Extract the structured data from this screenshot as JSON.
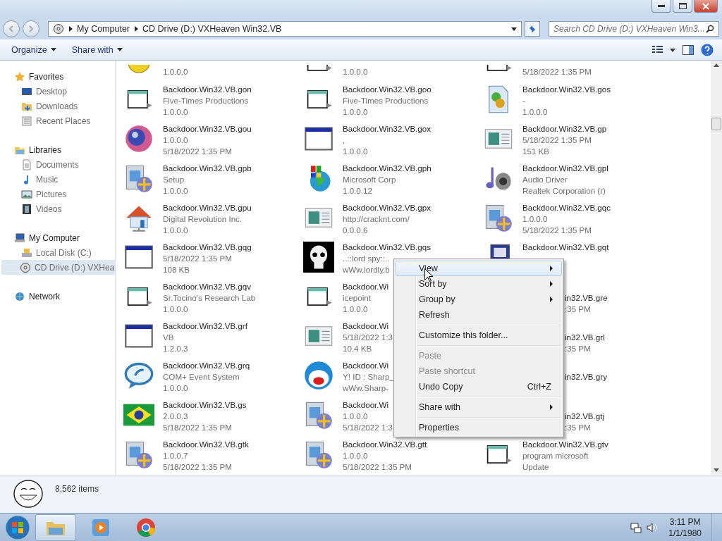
{
  "address_bar": {
    "crumbs": [
      "My Computer",
      "CD Drive (D:) VXHeaven Win32.VB"
    ]
  },
  "search": {
    "placeholder": "Search CD Drive (D:) VXHeaven Win3..."
  },
  "toolbar": {
    "buttons": [
      "Organize",
      "Share with"
    ]
  },
  "sidebar": {
    "groups": [
      {
        "label": "Favorites",
        "selected": false,
        "children": [
          {
            "label": "Desktop",
            "selected": false
          },
          {
            "label": "Downloads",
            "selected": false
          },
          {
            "label": "Recent Places",
            "selected": false
          }
        ]
      },
      {
        "label": "Libraries",
        "selected": false,
        "children": [
          {
            "label": "Documents",
            "selected": false
          },
          {
            "label": "Music",
            "selected": false
          },
          {
            "label": "Pictures",
            "selected": false
          },
          {
            "label": "Videos",
            "selected": false
          }
        ]
      },
      {
        "label": "My Computer",
        "selected": false,
        "children": [
          {
            "label": "Local Disk (C:)",
            "selected": false
          },
          {
            "label": "CD Drive (D:) VXHea",
            "selected": true
          }
        ]
      },
      {
        "label": "Network",
        "selected": false
      }
    ]
  },
  "files": {
    "rows": [
      [
        {
          "kind": "cut-top",
          "lines": [
            "1.0.0.0"
          ]
        },
        {
          "kind": "cut-top",
          "lines": [
            "1.0.0.0"
          ]
        },
        {
          "kind": "cut-top",
          "lines": [
            "5/18/2022 1:35 PM"
          ]
        }
      ],
      [
        {
          "kind": "full",
          "lines": [
            "Backdoor.Win32.VB.gon",
            "Five-Times Productions",
            "1.0.0.0"
          ]
        },
        {
          "kind": "full",
          "lines": [
            "Backdoor.Win32.VB.goo",
            "Five-Times Productions",
            "1.0.0.0"
          ]
        },
        {
          "kind": "full",
          "lines": [
            "Backdoor.Win32.VB.gos",
            "-",
            "1.0.0.0"
          ]
        }
      ],
      [
        {
          "kind": "full",
          "lines": [
            "Backdoor.Win32.VB.gou",
            "1.0.0.0",
            "5/18/2022 1:35 PM"
          ]
        },
        {
          "kind": "full",
          "lines": [
            "Backdoor.Win32.VB.gox",
            ",",
            "1.0.0.0"
          ]
        },
        {
          "kind": "full",
          "lines": [
            "Backdoor.Win32.VB.gp",
            "5/18/2022 1:35 PM",
            "151 KB"
          ]
        }
      ],
      [
        {
          "kind": "full",
          "lines": [
            "Backdoor.Win32.VB.gpb",
            "Setup",
            "1.0.0.0"
          ]
        },
        {
          "kind": "full",
          "lines": [
            "Backdoor.Win32.VB.gph",
            "Microsoft Corp",
            "1.0.0.12"
          ]
        },
        {
          "kind": "full",
          "lines": [
            "Backdoor.Win32.VB.gpl",
            "Audio Driver",
            "Realtek Corporation (r)"
          ]
        }
      ],
      [
        {
          "kind": "full",
          "lines": [
            "Backdoor.Win32.VB.gpu",
            "Digital Revolution Inc.",
            "1.0.0.0"
          ]
        },
        {
          "kind": "full",
          "lines": [
            "Backdoor.Win32.VB.gpx",
            "http://cracknt.com/",
            "0.0.0.6"
          ]
        },
        {
          "kind": "full",
          "lines": [
            "Backdoor.Win32.VB.gqc",
            "1.0.0.0",
            "5/18/2022 1:35 PM"
          ]
        }
      ],
      [
        {
          "kind": "full",
          "lines": [
            "Backdoor.Win32.VB.gqg",
            "5/18/2022 1:35 PM",
            "108 KB"
          ]
        },
        {
          "kind": "full",
          "lines": [
            "Backdoor.Win32.VB.gqs",
            "..::lord spy::..",
            "wWw.lordly.b"
          ]
        },
        {
          "kind": "full",
          "lines": [
            "Backdoor.Win32.VB.gqt"
          ]
        }
      ],
      [
        {
          "kind": "full",
          "lines": [
            "Backdoor.Win32.VB.gqv",
            "Sr.Tocino's Research Lab",
            "1.0.0.0"
          ]
        },
        {
          "kind": "full",
          "lines": [
            "Backdoor.Wi",
            "icepoint",
            "1.0.0.0"
          ]
        },
        {
          "kind": "tail",
          "lines": [
            "in32.VB.gre",
            ":35 PM"
          ]
        }
      ],
      [
        {
          "kind": "full",
          "lines": [
            "Backdoor.Win32.VB.grf",
            "VB",
            "1.2.0.3"
          ]
        },
        {
          "kind": "full",
          "lines": [
            "Backdoor.Wi",
            "5/18/2022 1:3",
            "10.4 KB"
          ]
        },
        {
          "kind": "tail",
          "lines": [
            "in32.VB.grl",
            ":35 PM"
          ]
        }
      ],
      [
        {
          "kind": "full",
          "lines": [
            "Backdoor.Win32.VB.grq",
            "COM+ Event System",
            "1.0.0.0"
          ]
        },
        {
          "kind": "full",
          "lines": [
            "Backdoor.Wi",
            "Y! ID : Sharp_",
            "wWw.Sharp-"
          ]
        },
        {
          "kind": "tail",
          "lines": [
            "in32.VB.gry"
          ]
        }
      ],
      [
        {
          "kind": "full",
          "lines": [
            "Backdoor.Win32.VB.gs",
            "2.0.0.3",
            "5/18/2022 1:35 PM"
          ]
        },
        {
          "kind": "full",
          "lines": [
            "Backdoor.Wi",
            "1.0.0.0",
            "5/18/2022 1:3"
          ]
        },
        {
          "kind": "tail",
          "lines": [
            "in32.VB.gtj",
            ":35 PM"
          ]
        }
      ],
      [
        {
          "kind": "full",
          "lines": [
            "Backdoor.Win32.VB.gtk",
            "1.0.0.7",
            "5/18/2022 1:35 PM"
          ]
        },
        {
          "kind": "full",
          "lines": [
            "Backdoor.Win32.VB.gtt",
            "1.0.0.0",
            "5/18/2022 1:35 PM"
          ]
        },
        {
          "kind": "full",
          "lines": [
            "Backdoor.Win32.VB.gtv",
            "program microsoft",
            "Update"
          ]
        }
      ]
    ]
  },
  "context_menu": {
    "items": [
      {
        "kind": "item",
        "label": "View",
        "submenu": true,
        "selected": true,
        "disabled": false
      },
      {
        "kind": "item",
        "label": "Sort by",
        "submenu": true,
        "selected": false,
        "disabled": false
      },
      {
        "kind": "item",
        "label": "Group by",
        "submenu": true,
        "selected": false,
        "disabled": false
      },
      {
        "kind": "item",
        "label": "Refresh",
        "submenu": false,
        "selected": false,
        "disabled": false
      },
      {
        "kind": "separator"
      },
      {
        "kind": "item",
        "label": "Customize this folder...",
        "submenu": false,
        "selected": false,
        "disabled": false
      },
      {
        "kind": "separator"
      },
      {
        "kind": "item",
        "label": "Paste",
        "submenu": false,
        "selected": false,
        "disabled": true
      },
      {
        "kind": "item",
        "label": "Paste shortcut",
        "submenu": false,
        "selected": false,
        "disabled": true
      },
      {
        "kind": "item",
        "label": "Undo Copy",
        "shortcut": "Ctrl+Z",
        "submenu": false,
        "selected": false,
        "disabled": false
      },
      {
        "kind": "separator"
      },
      {
        "kind": "item",
        "label": "Share with",
        "submenu": true,
        "selected": false,
        "disabled": false
      },
      {
        "kind": "separator"
      },
      {
        "kind": "item",
        "label": "Properties",
        "submenu": false,
        "selected": false,
        "disabled": false
      }
    ]
  },
  "details": {
    "count": "8,562 items"
  },
  "taskbar": {
    "apps": [
      {
        "kind": "explorer",
        "selected": true
      },
      {
        "kind": "media",
        "selected": false
      },
      {
        "kind": "browser",
        "selected": false
      }
    ],
    "clock": {
      "time": "3:11 PM",
      "date": "1/1/1980"
    }
  }
}
